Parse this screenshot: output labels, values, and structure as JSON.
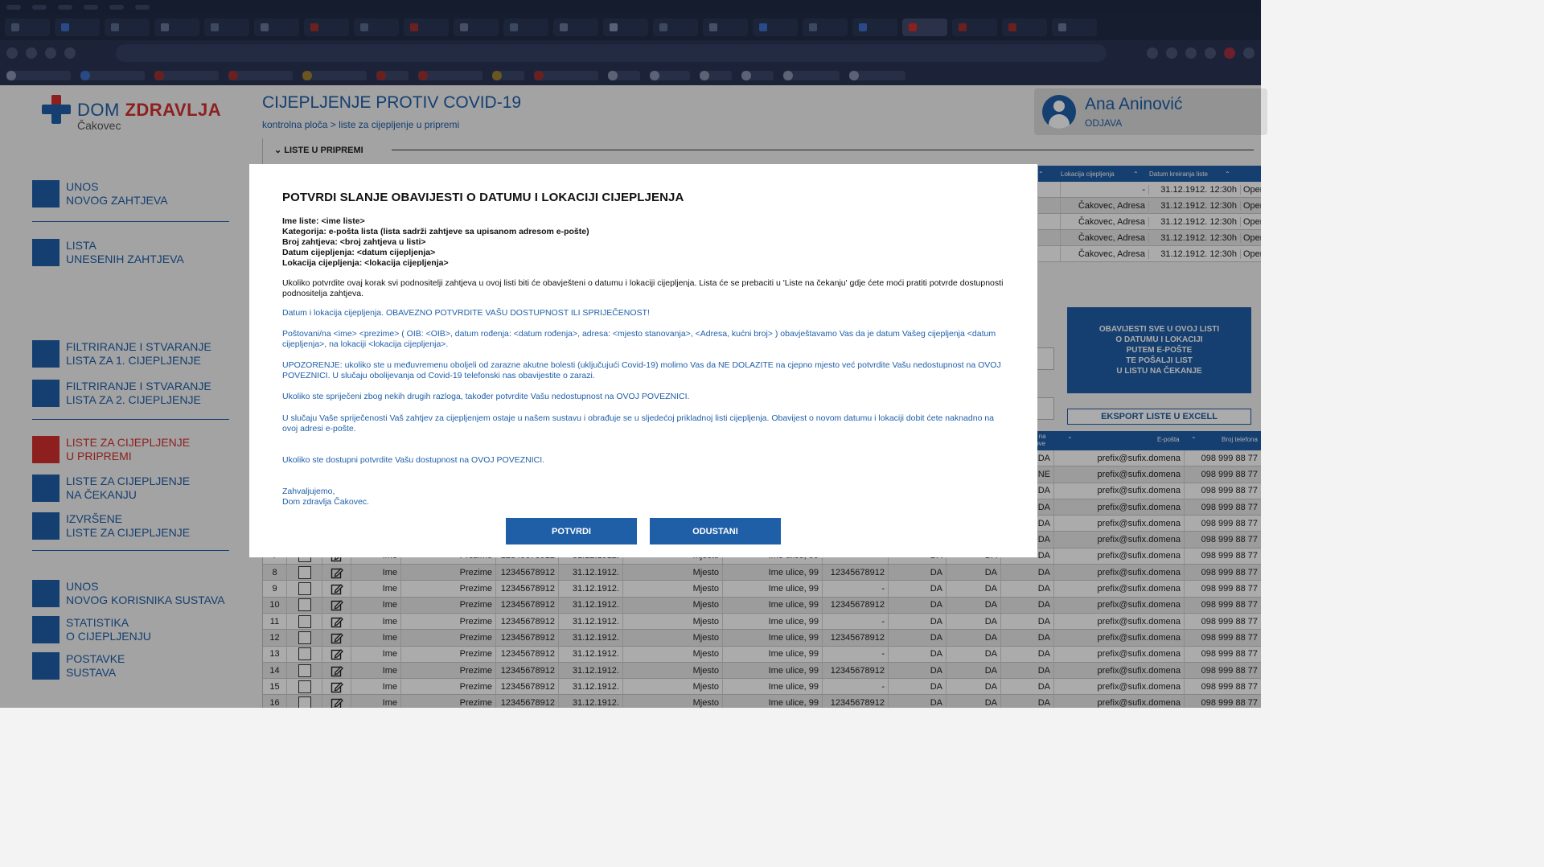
{
  "header": {
    "logo_main": "DOM",
    "logo_brand": "ZDRAVLJA",
    "logo_city": "Čakovec",
    "page_title": "CIJEPLJENJE PROTIV COVID-19",
    "breadcrumb": "kontrolna ploča > liste za cijepljenje u pripremi",
    "user_name": "Ana Aninović",
    "logout_label": "ODJAVA"
  },
  "sidebar": {
    "items": [
      {
        "label": "UNOS\nNOVOG ZAHTJEVA",
        "active": false
      },
      {
        "label": "LISTA\nUNESENIH ZAHTJEVA",
        "active": false
      },
      {
        "label": "FILTRIRANJE I STVARANJE\nLISTA ZA 1. CIJEPLJENJE",
        "active": false
      },
      {
        "label": "FILTRIRANJE I STVARANJE\nLISTA ZA 2. CIJEPLJENJE",
        "active": false
      },
      {
        "label": "LISTE ZA CIJEPLJENJE\nU PRIPREMI",
        "active": true
      },
      {
        "label": "LISTE ZA CIJEPLJENJE\nNA ČEKANJU",
        "active": false
      },
      {
        "label": "IZVRŠENE\nLISTE ZA CIJEPLJENJE",
        "active": false
      },
      {
        "label": "UNOS\nNOVOG KORISNIKA SUSTAVA",
        "active": false
      },
      {
        "label": "STATISTIKA\nO CIJEPLJENJU",
        "active": false
      },
      {
        "label": "POSTAVKE\nSUSTAVA",
        "active": false
      }
    ]
  },
  "main": {
    "section_title": "LISTE U PRIPREMI",
    "top_table": {
      "headers": [
        "Lokacija cijepljenja",
        "Datum kreiranja liste"
      ],
      "rows": [
        {
          "lokacija": "-",
          "datum": "31.12.1912. 12:30h",
          "action": "Opera"
        },
        {
          "lokacija": "Čakovec, Adresa",
          "datum": "31.12.1912. 12:30h",
          "action": "Opera"
        },
        {
          "lokacija": "Čakovec, Adresa",
          "datum": "31.12.1912. 12:30h",
          "action": "Opera"
        },
        {
          "lokacija": "Čakovec, Adresa",
          "datum": "31.12.1912. 12:30h",
          "action": "Opera"
        },
        {
          "lokacija": "Čakovec, Adresa",
          "datum": "31.12.1912. 12:30h",
          "action": "Opera"
        }
      ]
    },
    "notify_button": "OBAVIJESTI SVE U OVOJ LISTI\nO DATUMU I LOKACIJI\nPUTEM E-POŠTE\nTE POŠALJI LIST\nU LISTU NA ČEKANJE",
    "export_button": "EKSPORT LISTE U EXCELL",
    "main_table": {
      "headers": {
        "partial": "gije na\nlekove",
        "email": "E-pošta",
        "phone": "Broj telefona"
      },
      "rows": [
        {
          "num": "",
          "ime": "",
          "prezime": "",
          "oib": "",
          "datum": "",
          "mjesto": "",
          "adresa": "",
          "mbo": "",
          "a": "",
          "b": "",
          "c": "DA",
          "email": "prefix@sufix.domena",
          "phone": "098 999 88 77"
        },
        {
          "num": "",
          "ime": "",
          "prezime": "",
          "oib": "",
          "datum": "",
          "mjesto": "",
          "adresa": "",
          "mbo": "",
          "a": "",
          "b": "",
          "c": "NE",
          "email": "prefix@sufix.domena",
          "phone": "098 999 88 77"
        },
        {
          "num": "",
          "ime": "",
          "prezime": "",
          "oib": "",
          "datum": "",
          "mjesto": "",
          "adresa": "",
          "mbo": "",
          "a": "",
          "b": "",
          "c": "DA",
          "email": "prefix@sufix.domena",
          "phone": "098 999 88 77"
        },
        {
          "num": "",
          "ime": "",
          "prezime": "",
          "oib": "",
          "datum": "",
          "mjesto": "",
          "adresa": "",
          "mbo": "",
          "a": "",
          "b": "",
          "c": "DA",
          "email": "prefix@sufix.domena",
          "phone": "098 999 88 77"
        },
        {
          "num": "",
          "ime": "",
          "prezime": "",
          "oib": "",
          "datum": "",
          "mjesto": "",
          "adresa": "",
          "mbo": "",
          "a": "",
          "b": "",
          "c": "DA",
          "email": "prefix@sufix.domena",
          "phone": "098 999 88 77"
        },
        {
          "num": "",
          "ime": "",
          "prezime": "",
          "oib": "",
          "datum": "",
          "mjesto": "",
          "adresa": "",
          "mbo": "",
          "a": "",
          "b": "",
          "c": "DA",
          "email": "prefix@sufix.domena",
          "phone": "098 999 88 77"
        },
        {
          "num": "7",
          "ime": "Ime",
          "prezime": "Prezime",
          "oib": "12345678912",
          "datum": "31.12.1912.",
          "mjesto": "Mjesto",
          "adresa": "Ime ulice, 99",
          "mbo": "",
          "a": "DA",
          "b": "DA",
          "c": "DA",
          "email": "prefix@sufix.domena",
          "phone": "098 999 88 77"
        },
        {
          "num": "8",
          "ime": "Ime",
          "prezime": "Prezime",
          "oib": "12345678912",
          "datum": "31.12.1912.",
          "mjesto": "Mjesto",
          "adresa": "Ime ulice, 99",
          "mbo": "12345678912",
          "a": "DA",
          "b": "DA",
          "c": "DA",
          "email": "prefix@sufix.domena",
          "phone": "098 999 88 77"
        },
        {
          "num": "9",
          "ime": "Ime",
          "prezime": "Prezime",
          "oib": "12345678912",
          "datum": "31.12.1912.",
          "mjesto": "Mjesto",
          "adresa": "Ime ulice, 99",
          "mbo": "-",
          "a": "DA",
          "b": "DA",
          "c": "DA",
          "email": "prefix@sufix.domena",
          "phone": "098 999 88 77"
        },
        {
          "num": "10",
          "ime": "Ime",
          "prezime": "Prezime",
          "oib": "12345678912",
          "datum": "31.12.1912.",
          "mjesto": "Mjesto",
          "adresa": "Ime ulice, 99",
          "mbo": "12345678912",
          "a": "DA",
          "b": "DA",
          "c": "DA",
          "email": "prefix@sufix.domena",
          "phone": "098 999 88 77"
        },
        {
          "num": "11",
          "ime": "Ime",
          "prezime": "Prezime",
          "oib": "12345678912",
          "datum": "31.12.1912.",
          "mjesto": "Mjesto",
          "adresa": "Ime ulice, 99",
          "mbo": "-",
          "a": "DA",
          "b": "DA",
          "c": "DA",
          "email": "prefix@sufix.domena",
          "phone": "098 999 88 77"
        },
        {
          "num": "12",
          "ime": "Ime",
          "prezime": "Prezime",
          "oib": "12345678912",
          "datum": "31.12.1912.",
          "mjesto": "Mjesto",
          "adresa": "Ime ulice, 99",
          "mbo": "12345678912",
          "a": "DA",
          "b": "DA",
          "c": "DA",
          "email": "prefix@sufix.domena",
          "phone": "098 999 88 77"
        },
        {
          "num": "13",
          "ime": "Ime",
          "prezime": "Prezime",
          "oib": "12345678912",
          "datum": "31.12.1912.",
          "mjesto": "Mjesto",
          "adresa": "Ime ulice, 99",
          "mbo": "-",
          "a": "DA",
          "b": "DA",
          "c": "DA",
          "email": "prefix@sufix.domena",
          "phone": "098 999 88 77"
        },
        {
          "num": "14",
          "ime": "Ime",
          "prezime": "Prezime",
          "oib": "12345678912",
          "datum": "31.12.1912.",
          "mjesto": "Mjesto",
          "adresa": "Ime ulice, 99",
          "mbo": "12345678912",
          "a": "DA",
          "b": "DA",
          "c": "DA",
          "email": "prefix@sufix.domena",
          "phone": "098 999 88 77"
        },
        {
          "num": "15",
          "ime": "Ime",
          "prezime": "Prezime",
          "oib": "12345678912",
          "datum": "31.12.1912.",
          "mjesto": "Mjesto",
          "adresa": "Ime ulice, 99",
          "mbo": "-",
          "a": "DA",
          "b": "DA",
          "c": "DA",
          "email": "prefix@sufix.domena",
          "phone": "098 999 88 77"
        },
        {
          "num": "16",
          "ime": "Ime",
          "prezime": "Prezime",
          "oib": "12345678912",
          "datum": "31.12.1912.",
          "mjesto": "Mjesto",
          "adresa": "Ime ulice, 99",
          "mbo": "12345678912",
          "a": "DA",
          "b": "DA",
          "c": "DA",
          "email": "prefix@sufix.domena",
          "phone": "098 999 88 77"
        }
      ]
    }
  },
  "modal": {
    "title": "POTVRDI SLANJE OBAVIJESTI O DATUMU I LOKACIJI CIJEPLJENJA",
    "info": [
      "Ime liste: <ime liste>",
      "Kategorija: e-pošta lista (lista sadrži zahtjeve sa upisanom adresom e-pošte)",
      "Broj zahtjeva: <broj zahtjeva u listi>",
      "Datum cijepljenja: <datum cijepljenja>",
      "Lokacija cijepljenja: <lokacija cijepljenja>"
    ],
    "intro": "Ukoliko potvrdite ovaj korak svi podnositelji zahtjeva u ovoj listi biti će obavješteni o datumu i lokaciji cijepljenja. Lista će se prebaciti u 'Liste na čekanju' gdje ćete moći pratiti potvrde dostupnosti podnositelja zahtjeva.",
    "p1": "Datum i lokacija cijepljenja. OBAVEZNO POTVRDITE VAŠU DOSTUPNOST ILI SPRIJEČENOST!",
    "p2": "Poštovani/na <ime> <prezime> ( OIB: <OIB>, datum rođenja: <datum rođenja>, adresa: <mjesto stanovanja>, <Adresa, kućni broj> ) obavještavamo Vas da je datum Vašeg cijepljenja <datum cijepljenja>, na lokaciji <lokacija cijepljenja>.",
    "p3": "UPOZORENJE: ukoliko ste u međuvremenu oboljeli od zarazne akutne bolesti (uključujući Covid-19) molimo Vas da NE DOLAZITE na cjepno mjesto već potvrdite Vašu nedostupnost na OVOJ POVEZNICI. U slučaju obolijevanja od Covid-19 telefonski nas obavijestite o zarazi.",
    "p4": "Ukoliko ste spriječeni zbog nekih drugih razloga, također potvrdite Vašu nedostupnost na OVOJ POVEZNICI.",
    "p5": "U slučaju Vaše spriječenosti Vaš zahtjev za cijepljenjem ostaje u našem sustavu i obrađuje se u sljedećoj prikladnoj listi cijepljenja. Obavijest o novom datumu i lokaciji dobit ćete naknadno na ovoj adresi e-pošte.",
    "p6": "Ukoliko ste dostupni potvrdite Vašu dostupnost na OVOJ POVEZNICI.",
    "sign1": "Zahvaljujemo,",
    "sign2": "Dom zdravlja Čakovec.",
    "confirm_label": "POTVRDI",
    "cancel_label": "ODUSTANI"
  },
  "colors": {
    "brand_blue": "#1f5fa8",
    "brand_red": "#d2312d",
    "overlay": "rgba(0,0,0,0.33)"
  }
}
